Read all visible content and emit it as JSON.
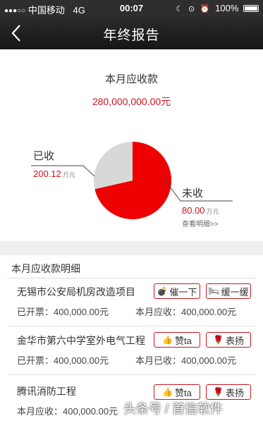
{
  "status_bar": {
    "carrier": "中国移动",
    "network": "4G",
    "time": "00:07",
    "battery": "100%"
  },
  "nav": {
    "title": "年终报告"
  },
  "summary": {
    "title": "本月应收款",
    "amount": "280,000,000.00元"
  },
  "chart_data": {
    "type": "pie",
    "slices": [
      {
        "label": "已收",
        "value": 200.12,
        "unit": "万元",
        "color": "#ee0000"
      },
      {
        "label": "未收",
        "value": 80.0,
        "unit": "万元",
        "color": "#d8d8d8"
      }
    ]
  },
  "chart_labels": {
    "received_label": "已收",
    "received_value": "200.12",
    "received_unit": "万元",
    "unreceived_label": "未收",
    "unreceived_value": "80.00",
    "unreceived_unit": "万元",
    "view_detail": "查看明细>>"
  },
  "section": {
    "title": "本月应收款明细"
  },
  "items": [
    {
      "name": "无锡市公安局机房改造项目",
      "line1": "已开票：400,000.00元",
      "line2": "本月应收：400,000.00元",
      "btn_a": {
        "label": "催一下",
        "icon": "bomb-icon",
        "glyph": "💣"
      },
      "btn_b": {
        "label": "缓一缓",
        "icon": "bed-icon",
        "glyph": "🛏"
      }
    },
    {
      "name": "金华市第六中学室外电气工程",
      "line1": "已开票：400,000.00元",
      "line2": "本月已收：400,000.00元",
      "btn_a": {
        "label": "赞ta",
        "icon": "thumbs-up-icon",
        "glyph": "👍"
      },
      "btn_b": {
        "label": "表扬",
        "icon": "rose-icon",
        "glyph": "🌹"
      }
    },
    {
      "name": "腾讯消防工程",
      "line1": "本月应收：400,000.00元",
      "line2": "",
      "btn_a": {
        "label": "赞ta",
        "icon": "thumbs-up-icon",
        "glyph": "👍"
      },
      "btn_b": {
        "label": "表扬",
        "icon": "rose-icon",
        "glyph": "🌹"
      }
    }
  ],
  "watermark": "头条号 / 首信软件",
  "colors": {
    "accent_red": "#c9151e",
    "pie_red": "#ee0000",
    "pie_gray": "#d8d8d8",
    "nav_bg": "#1c1c1c"
  }
}
